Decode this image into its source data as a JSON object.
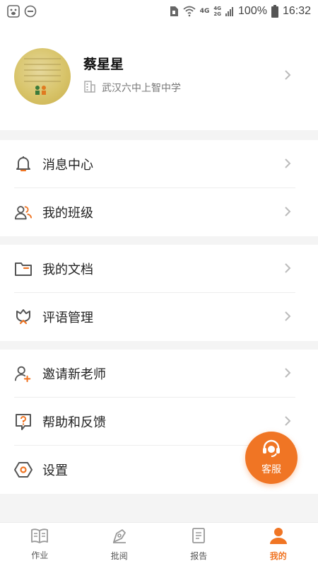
{
  "status_bar": {
    "left_icons": [
      "baidu-paw-icon",
      "do-not-disturb-icon"
    ],
    "network_top": "4G",
    "network_stack_top": "4G",
    "network_stack_bottom": "2G",
    "battery_percent": "100%",
    "time": "16:32"
  },
  "profile": {
    "name": "蔡星星",
    "school": "武汉六中上智中学"
  },
  "menu": {
    "messages": "消息中心",
    "my_class": "我的班级",
    "my_docs": "我的文档",
    "comments": "评语管理",
    "invite": "邀请新老师",
    "help": "帮助和反馈",
    "settings": "设置"
  },
  "fab": {
    "label": "客服"
  },
  "tabs": [
    {
      "label": "作业",
      "active": false
    },
    {
      "label": "批阅",
      "active": false
    },
    {
      "label": "报告",
      "active": false
    },
    {
      "label": "我的",
      "active": true
    }
  ],
  "colors": {
    "accent": "#f07524",
    "icon": "#555555",
    "chevron": "#bbbbbb"
  }
}
